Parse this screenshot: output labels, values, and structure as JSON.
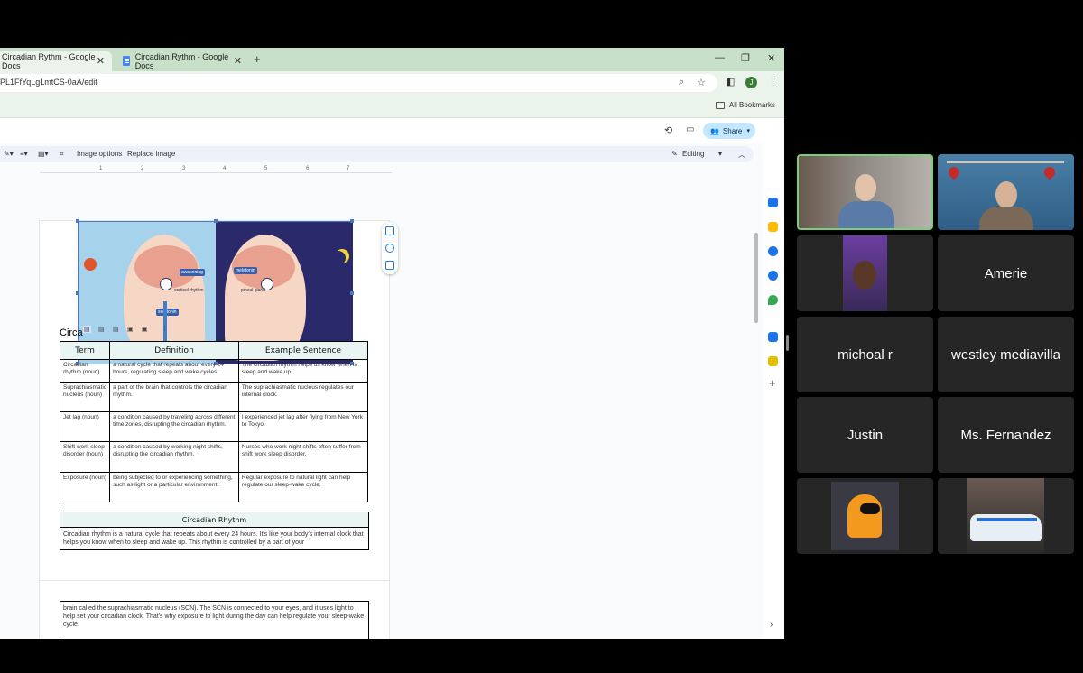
{
  "browser": {
    "tabs": [
      {
        "title": "Circadian Rythm - Google Docs",
        "active": true
      },
      {
        "title": "Circadian Rythm - Google Docs",
        "active": false
      }
    ],
    "url": "PL1FfYqLgLmtCS-0aA/edit",
    "bookmarks_label": "All Bookmarks",
    "profile_initial": "J"
  },
  "docs": {
    "share_label": "Share",
    "toolbar": {
      "image_options": "Image options",
      "replace_image": "Replace image",
      "mode": "Editing"
    },
    "ruler_marks": [
      "1",
      "2",
      "3",
      "4",
      "5",
      "6",
      "7"
    ],
    "image_labels": {
      "awakening": "awakening",
      "melatonin": "melatonin",
      "serotonin": "serotonin",
      "cortisol": "cortisol rhythm",
      "pineal": "pineal gland"
    },
    "heading_fragment": "Circa",
    "vocab_table": {
      "headers": [
        "Term",
        "Definition",
        "Example Sentence"
      ],
      "rows": [
        [
          "Circadian rhythm (noun)",
          "a natural cycle that repeats about every 24 hours, regulating sleep and wake cycles.",
          "The circadian rhythm helps us know when to sleep and wake up."
        ],
        [
          "Suprachiasmatic nucleus (noun)",
          "a part of the brain that controls the circadian rhythm.",
          "The suprachiasmatic nucleus regulates our internal clock."
        ],
        [
          "Jet lag (noun)",
          "a condition caused by traveling across different time zones, disrupting the circadian rhythm.",
          "I experienced jet lag after flying from New York to Tokyo."
        ],
        [
          "Shift work sleep disorder (noun)",
          "a condition caused by working night shifts, disrupting the circadian rhythm.",
          "Nurses who work night shifts often suffer from shift work sleep disorder."
        ],
        [
          "Exposure (noun)",
          "being subjected to or experiencing something, such as light or a particular environment.",
          "Regular exposure to natural light can help regulate our sleep-wake cycle."
        ]
      ]
    },
    "summary_table": {
      "header": "Circadian Rhythm",
      "text": "Circadian rhythm is a natural cycle that repeats about every 24 hours. It's like your body's internal clock that helps you know when to sleep and wake up. This rhythm is controlled by a part of your"
    },
    "page2_text": "brain called the suprachiasmatic nucleus (SCN). The SCN is connected to your eyes, and it uses light to help set your circadian clock. That's why exposure to light during the day can help regulate your sleep-wake cycle."
  },
  "participants": [
    {
      "name": "",
      "video": true,
      "speaking": true
    },
    {
      "name": "",
      "video": true,
      "speaking": false
    },
    {
      "name": "",
      "video": true,
      "speaking": false
    },
    {
      "name": "Amerie",
      "video": false
    },
    {
      "name": "michoal r",
      "video": false
    },
    {
      "name": "westley mediavilla",
      "video": false
    },
    {
      "name": "Justin",
      "video": false
    },
    {
      "name": "Ms. Fernandez",
      "video": false
    },
    {
      "name": "",
      "video": true
    },
    {
      "name": "",
      "video": true
    }
  ],
  "colors": {
    "browser_frame": "#c8dfc8",
    "share_button": "#c2e7ff",
    "table_header": "#e8f5f2",
    "tile_bg": "#262626",
    "speaking_border": "#7ad07a"
  }
}
